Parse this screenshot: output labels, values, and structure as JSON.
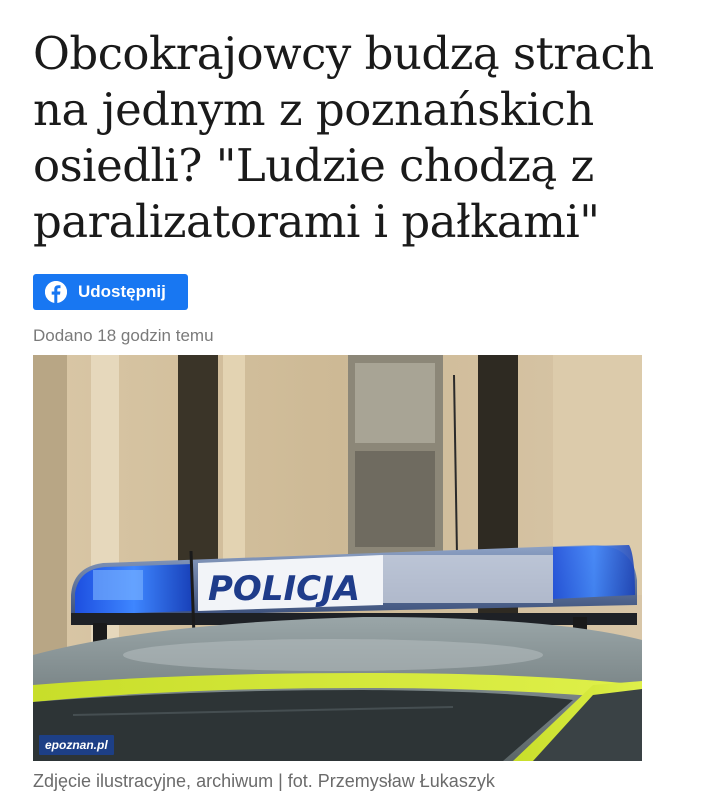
{
  "article": {
    "headline": "Obcokrajowcy budzą strach na jednym z poznańskich osiedli? \"Ludzie chodzą z paralizatorami i pałkami\"",
    "share_button_label": "Udostępnij",
    "share_icon": "facebook-icon",
    "added_time": "Dodano 18 godzin temu",
    "photo": {
      "subject": "police car light bar",
      "sign_text": "POLICJA",
      "watermark": "epoznan.pl"
    },
    "photo_caption": "Zdjęcie ilustracyjne, archiwum | fot. Przemysław Łukaszyk"
  },
  "colors": {
    "share_button": "#1877f2",
    "meta_text": "#7a7a7a",
    "caption_text": "#6b6b6b",
    "headline_text": "#1a1a1a"
  }
}
